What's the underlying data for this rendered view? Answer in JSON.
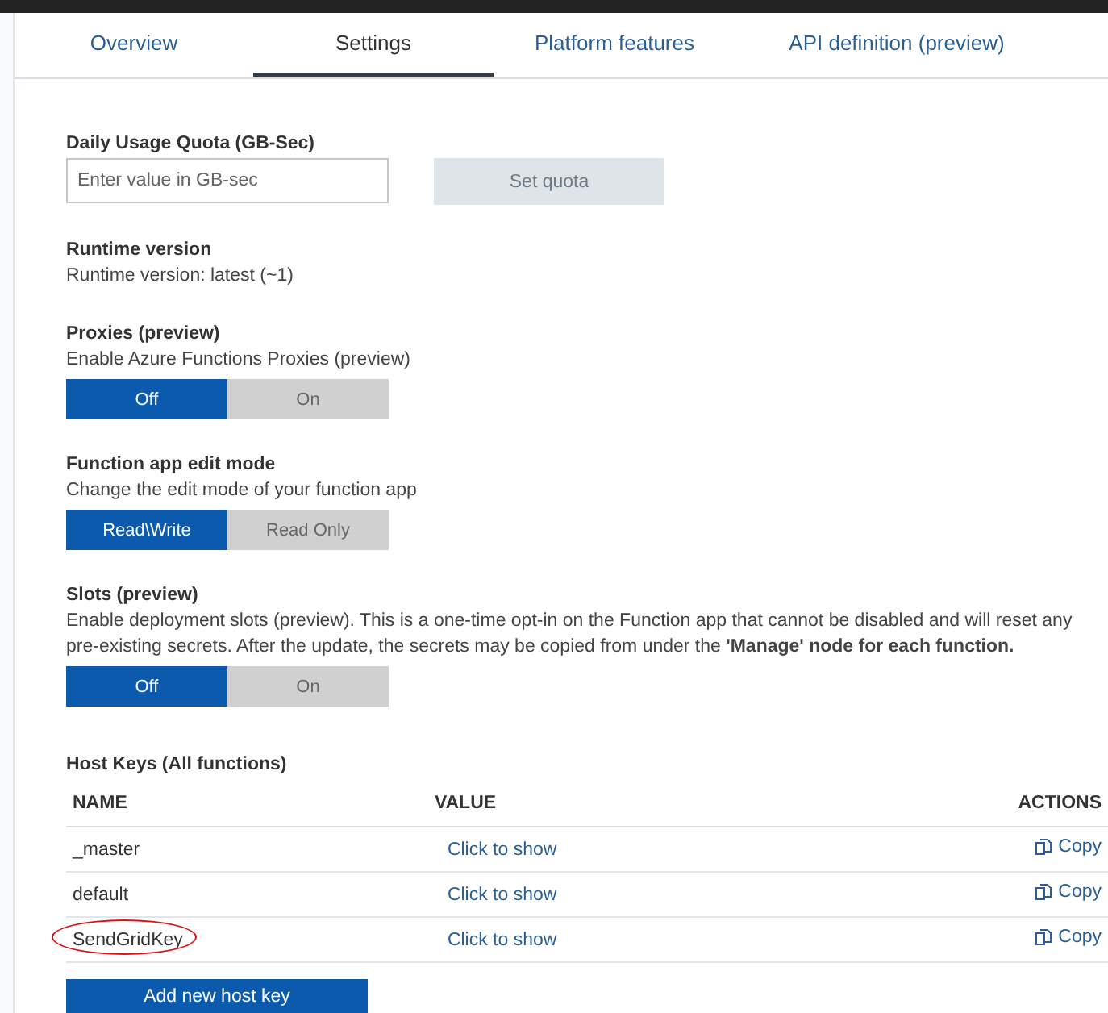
{
  "tabs": [
    {
      "label": "Overview",
      "selected": false
    },
    {
      "label": "Settings",
      "selected": true
    },
    {
      "label": "Platform features",
      "selected": false
    },
    {
      "label": "API definition (preview)",
      "selected": false
    }
  ],
  "quota": {
    "label": "Daily Usage Quota (GB-Sec)",
    "placeholder": "Enter value in GB-sec",
    "button": {
      "label": "Set quota",
      "disabled": true
    }
  },
  "runtime": {
    "label": "Runtime version",
    "text": "Runtime version: latest (~1)"
  },
  "settings": [
    {
      "title": "Proxies (preview)",
      "description": "Enable Azure Functions Proxies (preview)",
      "options": [
        {
          "label": "Off",
          "selected": true
        },
        {
          "label": "On",
          "selected": false
        }
      ]
    },
    {
      "title": "Function app edit mode",
      "description": "Change the edit mode of your function app",
      "options": [
        {
          "label": "Read\\Write",
          "selected": true
        },
        {
          "label": "Read Only",
          "selected": false
        }
      ]
    },
    {
      "title": "Slots (preview)",
      "description": "Enable deployment slots (preview). This is a one-time opt-in on the Function app that cannot be disabled and will reset any pre-existing secrets. After the update, the secrets may be copied from under the **'Manage' node for each function.**",
      "options": [
        {
          "label": "Off",
          "selected": true
        },
        {
          "label": "On",
          "selected": false
        }
      ]
    }
  ],
  "host_keys": {
    "title": "Host Keys (All functions)",
    "columns": [
      "NAME",
      "VALUE",
      "ACTIONS"
    ],
    "rows": [
      {
        "name": "_master",
        "value": "Click to show",
        "action": "Copy",
        "circled": false
      },
      {
        "name": "default",
        "value": "Click to show",
        "action": "Copy",
        "circled": false
      },
      {
        "name": "SendGridKey",
        "value": "Click to show",
        "action": "Copy",
        "circled": true
      }
    ],
    "add_button": "Add new host key"
  }
}
